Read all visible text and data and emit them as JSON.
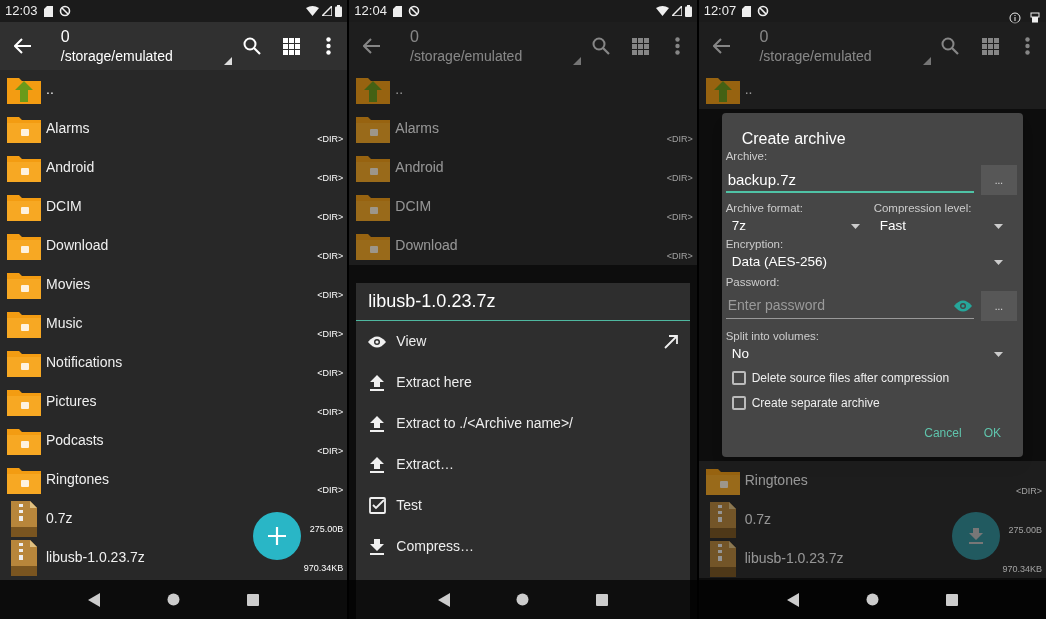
{
  "screens": [
    {
      "status_bar": {
        "time": "12:03",
        "extra_icons": false
      },
      "toolbar": {
        "title": "0",
        "path": "/storage/emulated"
      },
      "dimmed": false,
      "fab": {
        "kind": "add"
      },
      "items": [
        {
          "name": "..",
          "kind": "up"
        },
        {
          "name": "Alarms",
          "kind": "folder",
          "size": "<DIR>"
        },
        {
          "name": "Android",
          "kind": "folder",
          "size": "<DIR>"
        },
        {
          "name": "DCIM",
          "kind": "folder",
          "size": "<DIR>"
        },
        {
          "name": "Download",
          "kind": "folder",
          "size": "<DIR>"
        },
        {
          "name": "Movies",
          "kind": "folder",
          "size": "<DIR>"
        },
        {
          "name": "Music",
          "kind": "folder",
          "size": "<DIR>"
        },
        {
          "name": "Notifications",
          "kind": "folder",
          "size": "<DIR>"
        },
        {
          "name": "Pictures",
          "kind": "folder",
          "size": "<DIR>"
        },
        {
          "name": "Podcasts",
          "kind": "folder",
          "size": "<DIR>"
        },
        {
          "name": "Ringtones",
          "kind": "folder",
          "size": "<DIR>"
        },
        {
          "name": "0.7z",
          "kind": "archive",
          "size": "275.00B"
        },
        {
          "name": "libusb-1.0.23.7z",
          "kind": "archive",
          "size": "970.34KB"
        }
      ]
    },
    {
      "status_bar": {
        "time": "12:04",
        "extra_icons": false
      },
      "toolbar": {
        "title": "0",
        "path": "/storage/emulated"
      },
      "dimmed": true,
      "items": [
        {
          "name": "..",
          "kind": "up"
        },
        {
          "name": "Alarms",
          "kind": "folder",
          "size": "<DIR>"
        },
        {
          "name": "Android",
          "kind": "folder",
          "size": "<DIR>"
        },
        {
          "name": "DCIM",
          "kind": "folder",
          "size": "<DIR>"
        },
        {
          "name": "Download",
          "kind": "folder",
          "size": "<DIR>"
        }
      ],
      "overlay": {
        "kind": "menu",
        "title": "libusb-1.0.23.7z",
        "items": [
          {
            "label": "View",
            "kind": "view"
          },
          {
            "label": "Extract here",
            "kind": "extract"
          },
          {
            "label": "Extract to ./<Archive name>/",
            "kind": "extract"
          },
          {
            "label": "Extract…",
            "kind": "extract"
          },
          {
            "label": "Test",
            "kind": "test"
          },
          {
            "label": "Compress…",
            "kind": "compress"
          }
        ]
      }
    },
    {
      "status_bar": {
        "time": "12:07",
        "extra_icons": true
      },
      "toolbar": {
        "title": "0",
        "path": "/storage/emulated"
      },
      "dimmed": true,
      "fab": {
        "kind": "download"
      },
      "items": [
        {
          "name": "..",
          "kind": "up"
        }
      ],
      "overlay": {
        "kind": "dialog",
        "title": "Create archive",
        "archive": {
          "label": "Archive:",
          "value": "backup.7z",
          "browse": "..."
        },
        "format": {
          "label": "Archive format:",
          "value": "7z"
        },
        "level": {
          "label": "Compression level:",
          "value": "Fast"
        },
        "encryption": {
          "label": "Encryption:",
          "value": "Data (AES-256)"
        },
        "password": {
          "label": "Password:",
          "placeholder": "Enter password",
          "browse": "..."
        },
        "split": {
          "label": "Split into volumes:",
          "value": "No"
        },
        "checkboxes": [
          {
            "label": "Delete source files after compression",
            "checked": false
          },
          {
            "label": "Create separate archive",
            "checked": false
          }
        ],
        "buttons": [
          "Cancel",
          "OK"
        ]
      },
      "items_below": [
        {
          "name": "Ringtones",
          "kind": "folder",
          "size": "<DIR>"
        },
        {
          "name": "0.7z",
          "kind": "archive",
          "size": "275.00B"
        },
        {
          "name": "libusb-1.0.23.7z",
          "kind": "archive",
          "size": "970.34KB"
        }
      ]
    }
  ]
}
